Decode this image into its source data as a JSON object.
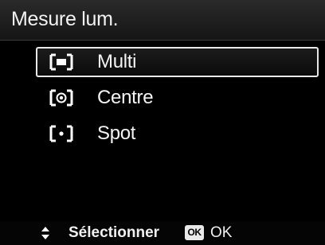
{
  "header": {
    "title": "Mesure lum."
  },
  "menu": {
    "items": [
      {
        "label": "Multi",
        "icon": "multi-metering-icon",
        "selected": true
      },
      {
        "label": "Centre",
        "icon": "center-weighted-metering-icon",
        "selected": false
      },
      {
        "label": "Spot",
        "icon": "spot-metering-icon",
        "selected": false
      }
    ]
  },
  "footer": {
    "select_label": "Sélectionner",
    "select_icon": "up-down-arrows-icon",
    "ok_badge": "OK",
    "ok_label": "OK"
  },
  "colors": {
    "background": "#000000",
    "text": "#ffffff",
    "selection_border": "#e8e8e8"
  }
}
